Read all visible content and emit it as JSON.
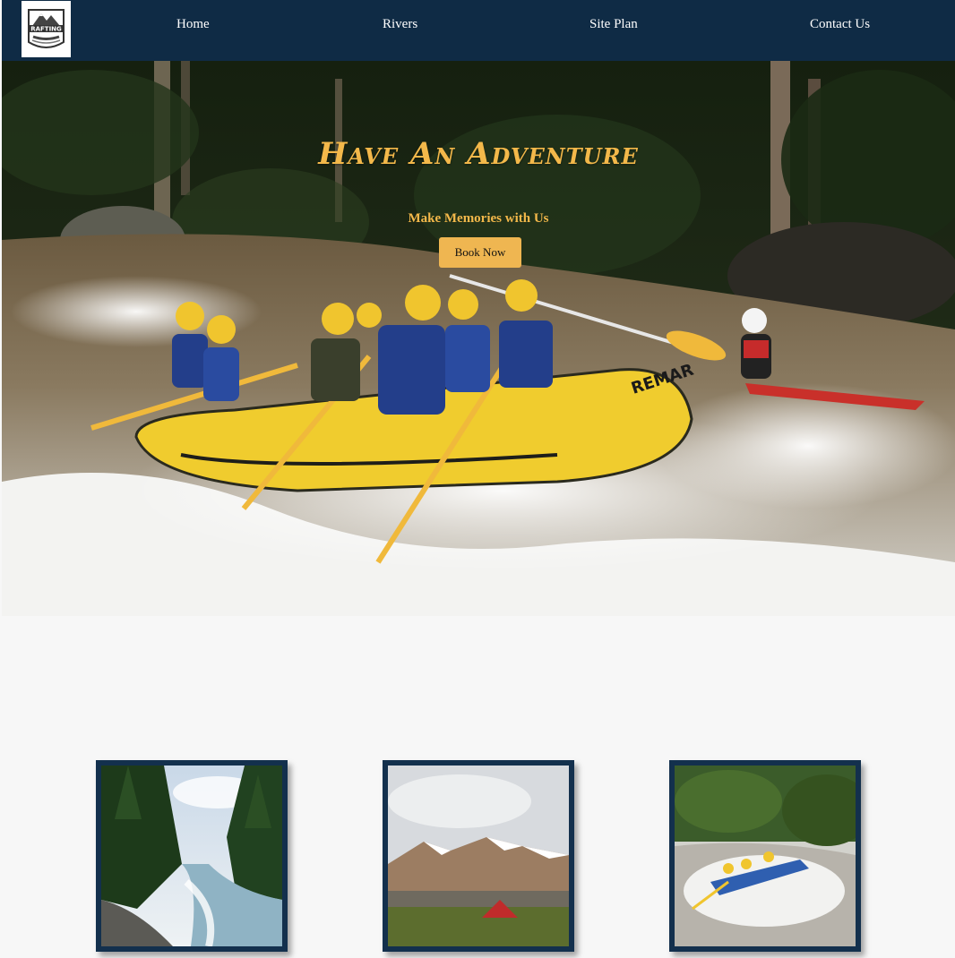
{
  "brand": {
    "logo_text": "RAFTING",
    "icon": "mountain-raft-logo-icon"
  },
  "nav": {
    "items": [
      {
        "label": "Home"
      },
      {
        "label": "Rivers"
      },
      {
        "label": "Site Plan"
      },
      {
        "label": "Contact Us"
      }
    ]
  },
  "hero": {
    "title": "Have An Adventure",
    "subtitle": "Make Memories with Us",
    "cta_label": "Book Now",
    "raft_text": "REMAR",
    "image_subject": "whitewater-rafting-photo"
  },
  "colors": {
    "navy": "#0f2b45",
    "accent": "#efb651",
    "background": "#f7f7f7"
  },
  "gallery": [
    {
      "image_subject": "forest-river-photo"
    },
    {
      "image_subject": "mountain-camping-photo"
    },
    {
      "image_subject": "rafting-group-photo"
    }
  ]
}
